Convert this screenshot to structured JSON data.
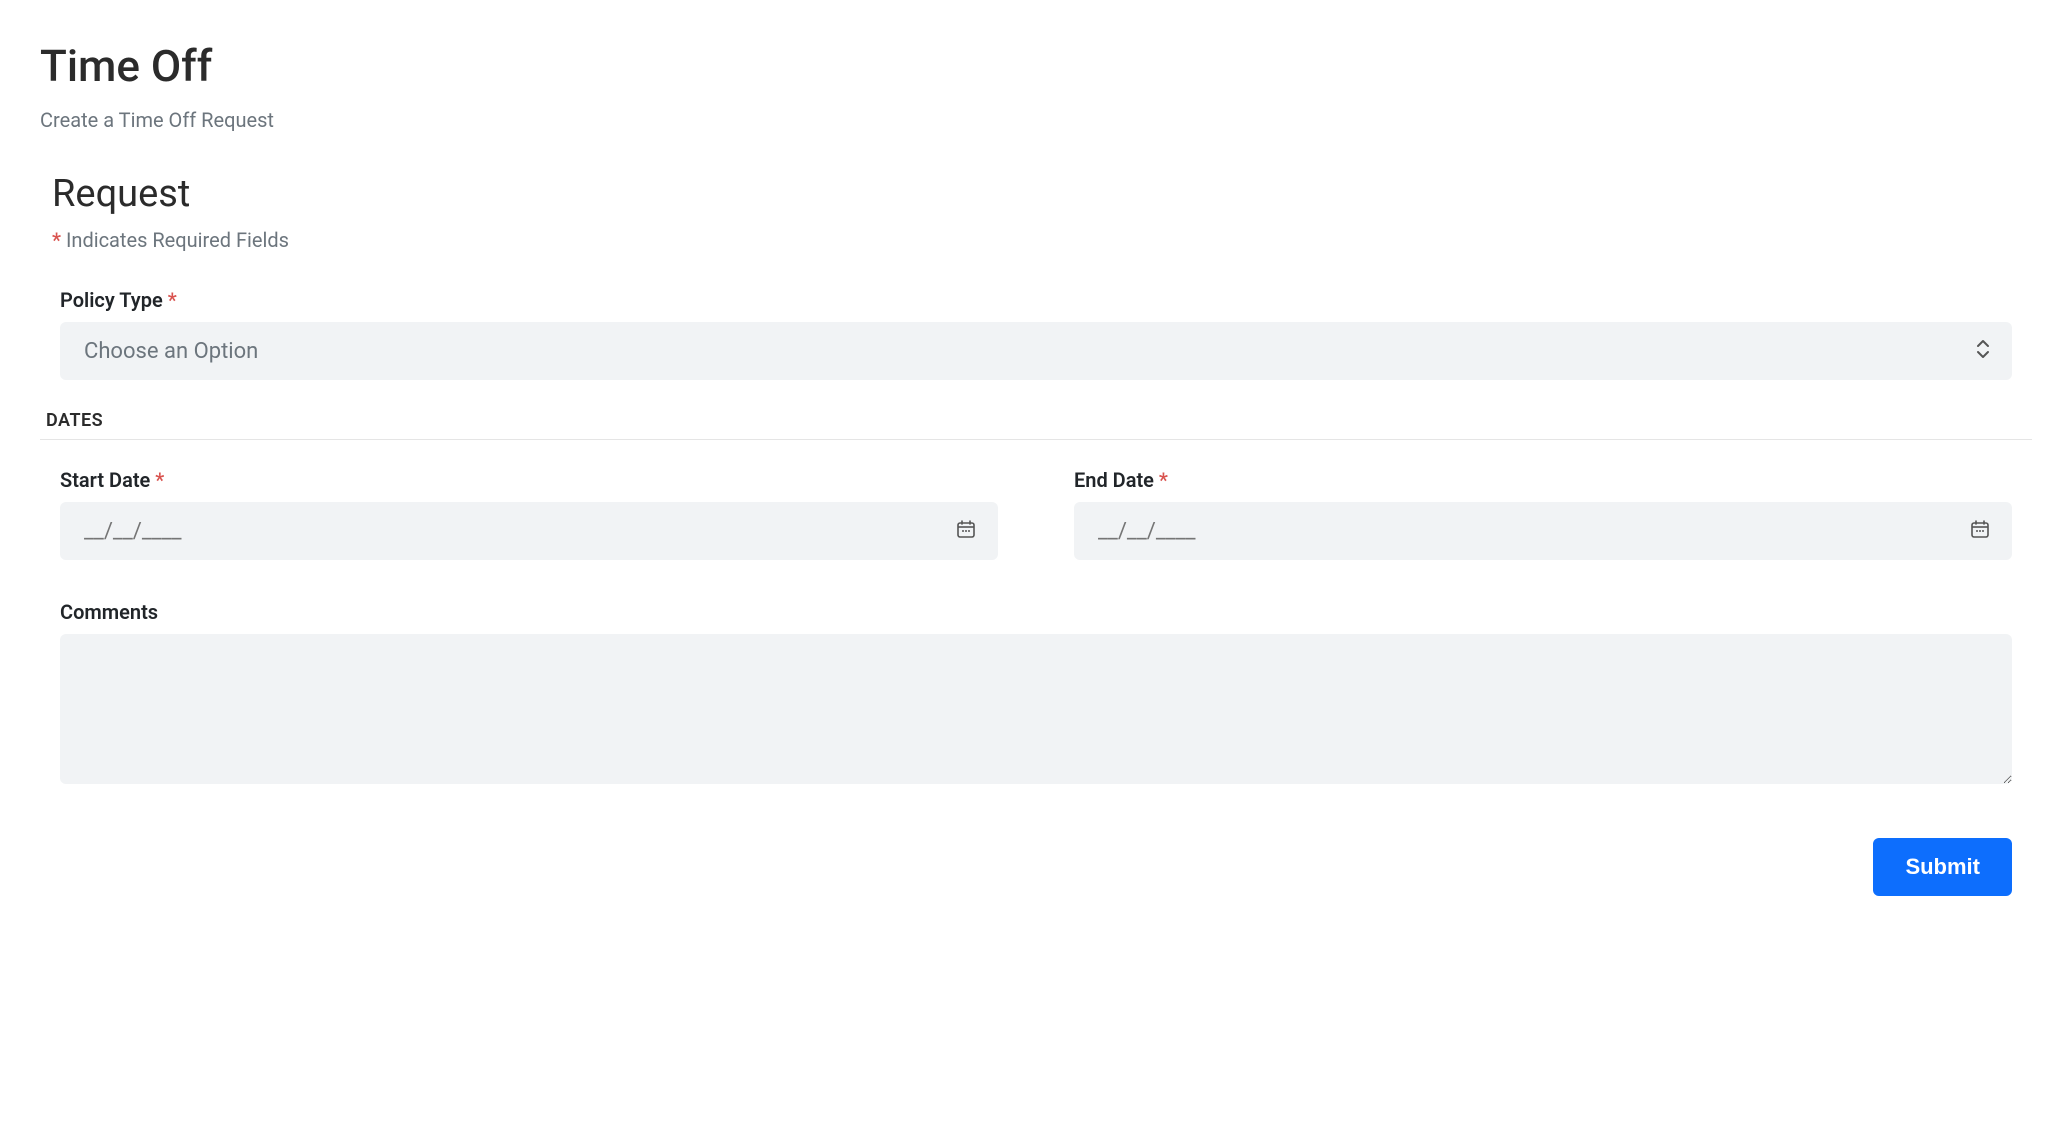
{
  "header": {
    "title": "Time Off",
    "subtitle": "Create a Time Off Request"
  },
  "form": {
    "section_title": "Request",
    "required_note": "Indicates Required Fields",
    "policy_type": {
      "label": "Policy Type",
      "placeholder": "Choose an Option"
    },
    "dates_section_label": "DATES",
    "start_date": {
      "label": "Start Date",
      "placeholder": "__/__/____"
    },
    "end_date": {
      "label": "End Date",
      "placeholder": "__/__/____"
    },
    "comments": {
      "label": "Comments",
      "value": ""
    },
    "submit_label": "Submit"
  }
}
